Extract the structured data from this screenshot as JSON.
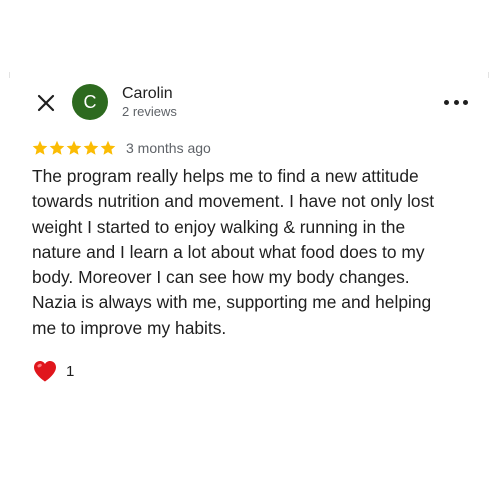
{
  "reviewer": {
    "initial": "C",
    "name": "Carolin",
    "review_count": "2 reviews",
    "avatar_color": "#2d6a1f"
  },
  "review": {
    "rating": 5,
    "max_rating": 5,
    "star_color": "#fbbc04",
    "date": "3 months ago",
    "text": "The program really helps me to find a new attitude\ntowards nutrition and movement. I have not only lost\nweight I started to enjoy walking & running in the\nnature and I learn a lot about what food does to my\nbody. Moreover I can see how my body changes.\nNazia is always with me, supporting me and helping\nme to improve my habits."
  },
  "reactions": {
    "icon": "heart-icon",
    "count": "1"
  },
  "controls": {
    "close_icon": "close-icon",
    "more_icon": "more-horizontal-icon"
  }
}
